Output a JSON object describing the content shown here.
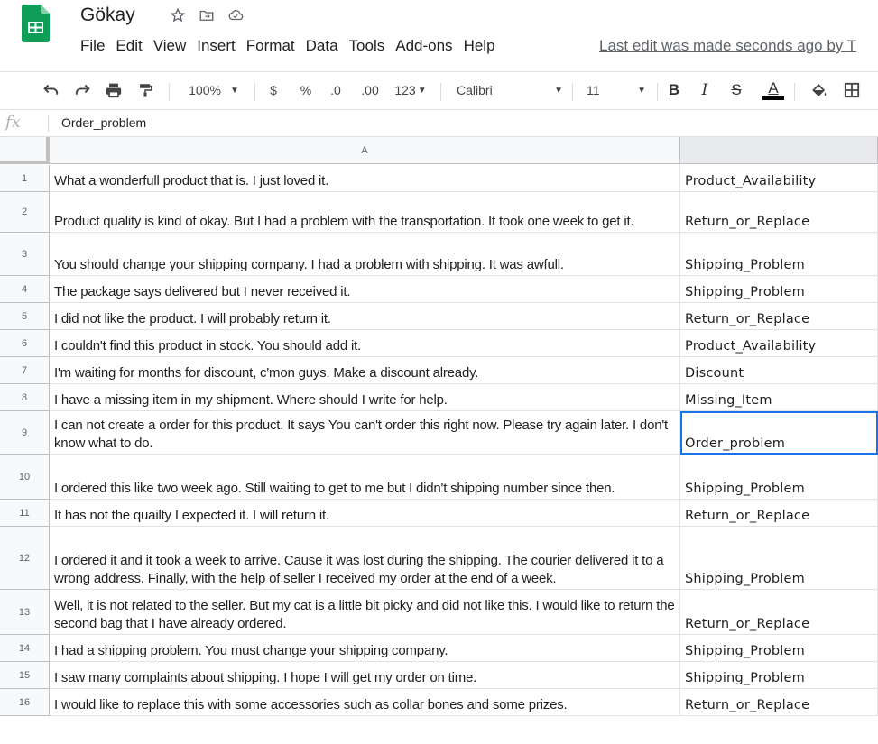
{
  "doc": {
    "title": "Gökay",
    "last_edit": "Last edit was made seconds ago by T"
  },
  "menu": [
    "File",
    "Edit",
    "View",
    "Insert",
    "Format",
    "Data",
    "Tools",
    "Add-ons",
    "Help"
  ],
  "toolbar": {
    "zoom": "100%",
    "currency": "$",
    "percent": "%",
    "decrease_decimal": ".0",
    "increase_decimal": ".00",
    "more_formats": "123",
    "font": "Calibri",
    "font_size": "11",
    "bold": "B",
    "italic": "I",
    "strikethrough": "S",
    "text_color": "A"
  },
  "formula_bar": {
    "fx_label": "fx",
    "value": "Order_problem"
  },
  "sheet": {
    "col_a_header": "A",
    "selected_row": 9,
    "rows": [
      {
        "num": "1",
        "a": "What a wonderfull product that is. I just loved it.",
        "b": "Product_Availability"
      },
      {
        "num": "2",
        "a": "Product quality is kind of okay. But I had a problem with the transportation. It took one week to get it.",
        "b": "Return_or_Replace"
      },
      {
        "num": "3",
        "a": "You should change your shipping company. I had a problem with shipping. It was awfull.",
        "b": "Shipping_Problem"
      },
      {
        "num": "4",
        "a": "The package says delivered but I never received it.",
        "b": "Shipping_Problem"
      },
      {
        "num": "5",
        "a": "I did not like the product. I will probably return it.",
        "b": "Return_or_Replace"
      },
      {
        "num": "6",
        "a": "I couldn't find this product in stock. You should add it.",
        "b": "Product_Availability"
      },
      {
        "num": "7",
        "a": "I'm waiting for months for discount, c'mon guys. Make a discount already.",
        "b": "Discount"
      },
      {
        "num": "8",
        "a": "I have a missing item in my shipment. Where should I write for help.",
        "b": "Missing_Item"
      },
      {
        "num": "9",
        "a": "I can not create a order for this product. It says You can't order this right now. Please try again later. I don't know what to do.",
        "b": "Order_problem"
      },
      {
        "num": "10",
        "a": "I ordered this like two week ago. Still waiting to get to me but I didn't shipping number since then.",
        "b": "Shipping_Problem"
      },
      {
        "num": "11",
        "a": "It has not the quailty I expected it. I will return it.",
        "b": "Return_or_Replace"
      },
      {
        "num": "12",
        "a": "I ordered it and it took a week to arrive. Cause it was lost during the shipping. The courier delivered it to a wrong address. Finally, with the help of seller I received my order at the end of a week.",
        "b": "Shipping_Problem"
      },
      {
        "num": "13",
        "a": "Well, it is not related to the seller. But my cat is a little bit picky and did not like this. I would like to return the second bag that I have already ordered.",
        "b": "Return_or_Replace"
      },
      {
        "num": "14",
        "a": "I had a shipping problem. You must change your shipping company.",
        "b": "Shipping_Problem"
      },
      {
        "num": "15",
        "a": "I saw many complaints about shipping. I hope I will get my order on time.",
        "b": "Shipping_Problem"
      },
      {
        "num": "16",
        "a": "I would like to replace this with some accessories such as collar bones and some prizes.",
        "b": "Return_or_Replace"
      }
    ]
  },
  "colors": {
    "sheets_green": "#0f9d58",
    "selection_blue": "#1a73e8"
  }
}
